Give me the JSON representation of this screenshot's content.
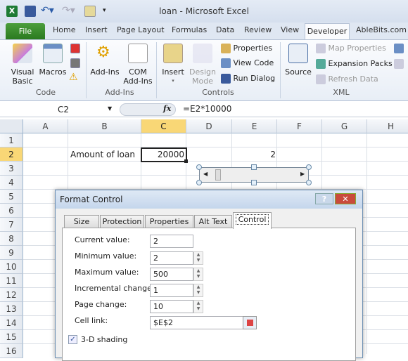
{
  "window": {
    "title": "loan - Microsoft Excel"
  },
  "tabs": [
    "File",
    "Home",
    "Insert",
    "Page Layout",
    "Formulas",
    "Data",
    "Review",
    "View",
    "Developer",
    "AbleBits.com"
  ],
  "ribbon": {
    "code": {
      "label": "Code",
      "visual_basic": "Visual Basic",
      "macros": "Macros"
    },
    "addins": {
      "label": "Add-Ins",
      "addins": "Add-Ins",
      "com": "COM Add-Ins"
    },
    "controls": {
      "label": "Controls",
      "insert": "Insert",
      "design": "Design Mode",
      "properties": "Properties",
      "view_code": "View Code",
      "run_dialog": "Run Dialog"
    },
    "xml": {
      "label": "XML",
      "source": "Source",
      "map_properties": "Map Properties",
      "expansion_packs": "Expansion Packs",
      "refresh_data": "Refresh Data"
    }
  },
  "formula_bar": {
    "name_box": "C2",
    "fx": "fx",
    "formula": "=E2*10000"
  },
  "columns": [
    "A",
    "B",
    "C",
    "D",
    "E",
    "F",
    "G",
    "H"
  ],
  "rows": [
    "1",
    "2",
    "3",
    "4",
    "5",
    "6",
    "7",
    "8",
    "9",
    "10",
    "11",
    "12",
    "13",
    "14",
    "15",
    "16"
  ],
  "cells": {
    "B2": "Amount of loan",
    "C2": "20000",
    "E2": "2"
  },
  "dialog": {
    "title": "Format Control",
    "tabs": [
      "Size",
      "Protection",
      "Properties",
      "Alt Text",
      "Control"
    ],
    "active_tab": "Control",
    "fields": {
      "current": {
        "label": "Current value:",
        "value": "2"
      },
      "min": {
        "label": "Minimum value:",
        "value": "2"
      },
      "max": {
        "label": "Maximum value:",
        "value": "500"
      },
      "inc": {
        "label": "Incremental change:",
        "value": "1"
      },
      "page": {
        "label": "Page change:",
        "value": "10"
      },
      "link": {
        "label": "Cell link:",
        "value": "$E$2"
      }
    },
    "shading": {
      "label": "3-D shading",
      "checked": true
    },
    "help": "?",
    "close": "✕"
  }
}
